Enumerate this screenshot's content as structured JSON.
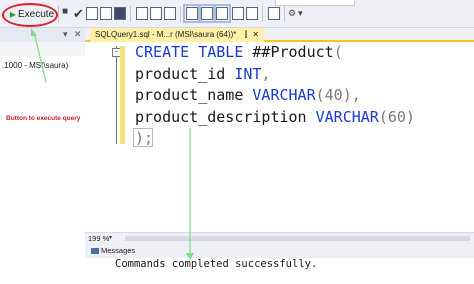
{
  "toolbar": {
    "execute_label": "Execute",
    "play_glyph": "▶",
    "check_glyph": "✔"
  },
  "object_explorer": {
    "server_label": ".1000 - MSI\\saura)"
  },
  "annotations": {
    "execute_note": "Button to execute query"
  },
  "editor_tab": {
    "label": "SQLQuery1.sql - M...r (MSI\\saura (64))*",
    "pin": "⫿",
    "close": "✕"
  },
  "editor": {
    "line1_kw1": "CREATE",
    "line1_kw2": "TABLE",
    "line1_rest": " ##Product",
    "line1_paren": "(",
    "line2_ident": "product_id",
    "line2_type": "INT",
    "line2_punct": ",",
    "line3_ident": "product_name",
    "line3_type": "VARCHAR",
    "line3_args": "(40)",
    "line3_punct": ",",
    "line4_ident": "product_description",
    "line4_type": "VARCHAR",
    "line4_args": "(60)",
    "line5": ");"
  },
  "status": {
    "zoom": "199 %"
  },
  "messages": {
    "tab_label": "Messages",
    "text": "Commands completed successfully."
  },
  "colors": {
    "keyword": "#1a3ad6",
    "annotation_red": "#d9252b",
    "annotation_green": "#7fdc85",
    "active_tab": "#fff0a8"
  }
}
